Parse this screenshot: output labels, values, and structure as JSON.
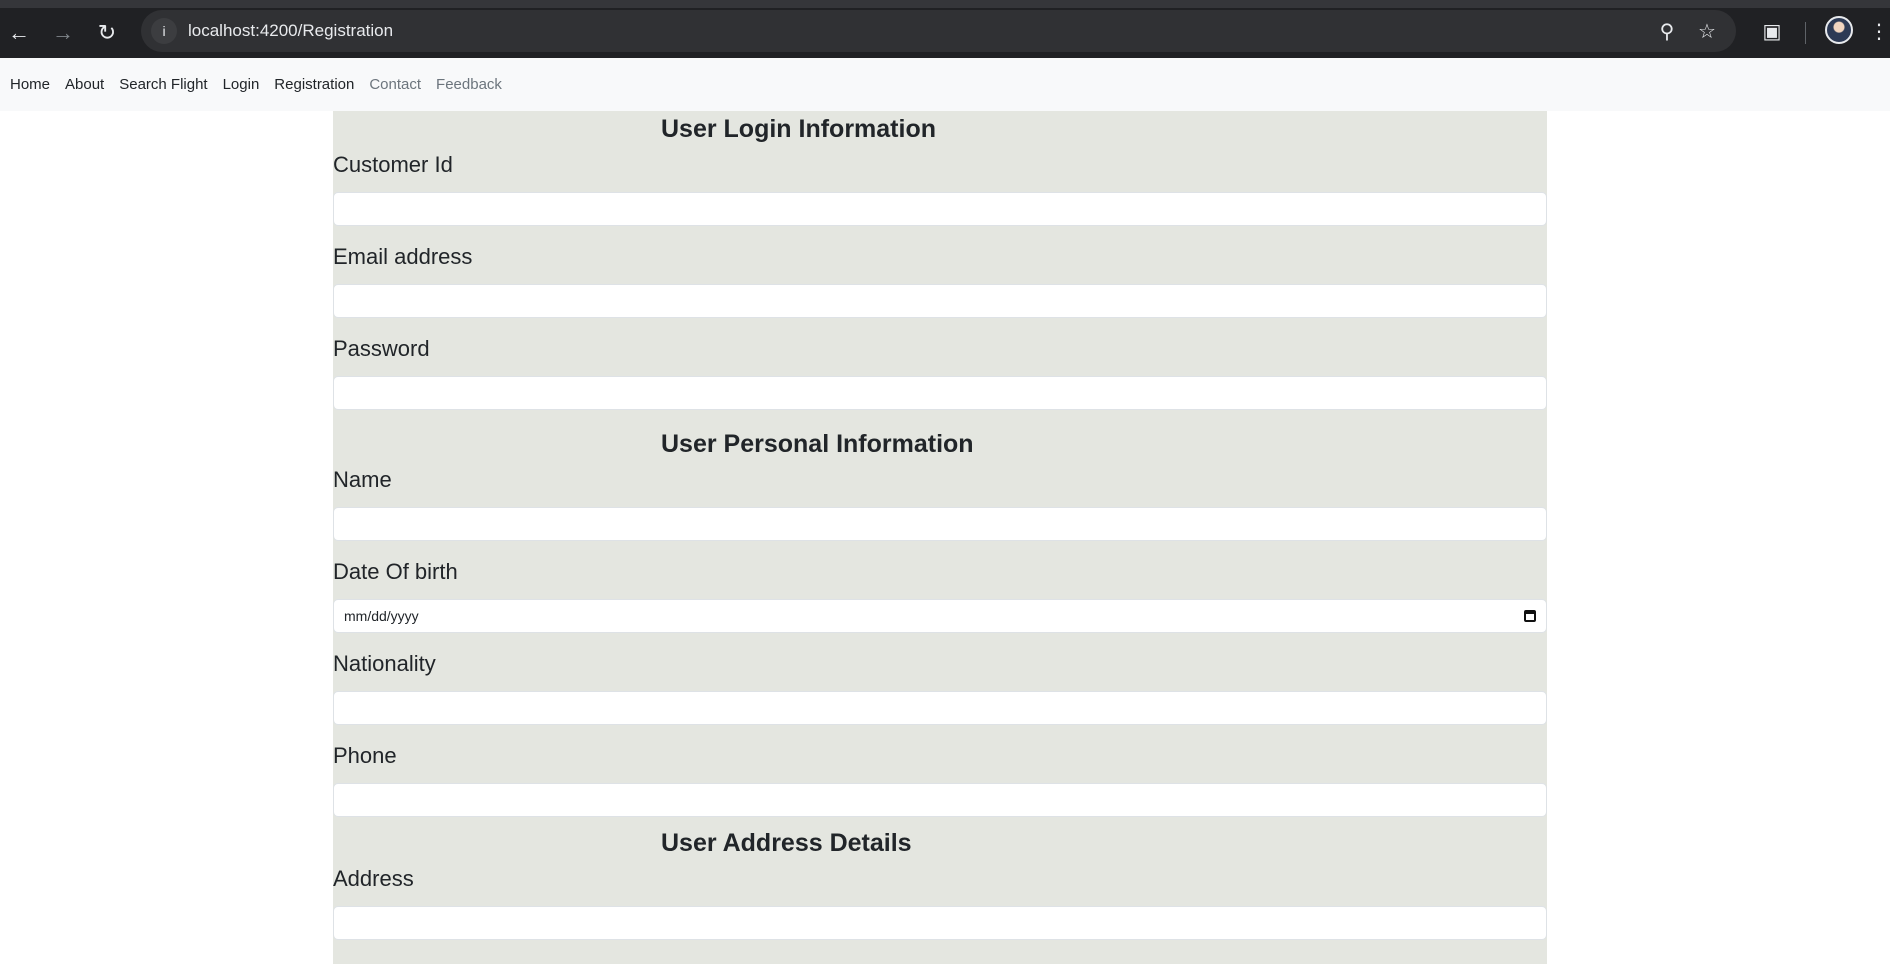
{
  "browser": {
    "url": "localhost:4200/Registration",
    "icons": [
      "back-arrow-icon",
      "forward-arrow-icon",
      "reload-icon",
      "site-info-icon",
      "zoom-icon",
      "bookmark-star-icon",
      "extensions-icon",
      "profile-avatar",
      "menu-icon"
    ]
  },
  "navbar": {
    "links": [
      {
        "label": "Home"
      },
      {
        "label": "About"
      },
      {
        "label": "Search Flight"
      },
      {
        "label": "Login"
      },
      {
        "label": "Registration"
      },
      {
        "label": "Contact"
      },
      {
        "label": "Feedback"
      }
    ]
  },
  "form": {
    "login_section": {
      "title": "User Login Information",
      "customer_id_label": "Customer Id",
      "email_label": "Email address",
      "password_label": "Password"
    },
    "personal_section": {
      "title": "User Personal Information",
      "name_label": "Name",
      "dob_label": "Date Of birth",
      "dob_placeholder": "mm/dd/yyyy",
      "nationality_label": "Nationality",
      "phone_label": "Phone"
    },
    "address_section": {
      "title": "User Address Details",
      "address_label": "Address"
    }
  },
  "colors": {
    "panel_background": "#e4e6e0",
    "chrome_background": "#202124",
    "navbar_background": "#f8f9fa"
  }
}
